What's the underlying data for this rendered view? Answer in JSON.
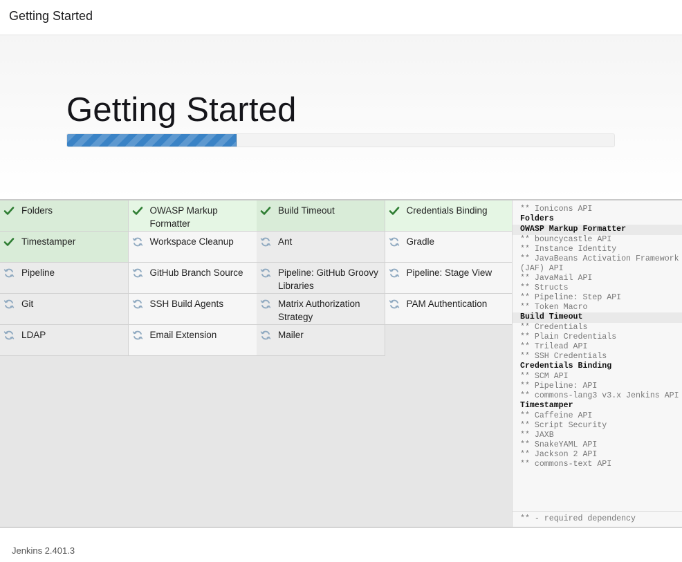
{
  "header": {
    "title": "Getting Started"
  },
  "hero": {
    "title": "Getting Started",
    "progress_fraction": 0.31
  },
  "colors": {
    "success_check": "#2e7d32",
    "spinner": "#8fa9c0",
    "progress": "#3a83c6"
  },
  "plugins": [
    {
      "label": "Folders",
      "status": "installed",
      "icon": "check-icon"
    },
    {
      "label": "OWASP Markup Formatter",
      "status": "installed",
      "icon": "check-icon"
    },
    {
      "label": "Build Timeout",
      "status": "installed",
      "icon": "check-icon"
    },
    {
      "label": "Credentials Binding",
      "status": "installed",
      "icon": "check-icon"
    },
    {
      "label": "Timestamper",
      "status": "installed",
      "icon": "check-icon"
    },
    {
      "label": "Workspace Cleanup",
      "status": "pending",
      "icon": "refresh-icon"
    },
    {
      "label": "Ant",
      "status": "pending",
      "icon": "refresh-icon"
    },
    {
      "label": "Gradle",
      "status": "pending",
      "icon": "refresh-icon"
    },
    {
      "label": "Pipeline",
      "status": "pending",
      "icon": "refresh-icon"
    },
    {
      "label": "GitHub Branch Source",
      "status": "pending",
      "icon": "refresh-icon"
    },
    {
      "label": "Pipeline: GitHub Groovy Libraries",
      "status": "pending",
      "icon": "refresh-icon"
    },
    {
      "label": "Pipeline: Stage View",
      "status": "pending",
      "icon": "refresh-icon"
    },
    {
      "label": "Git",
      "status": "pending",
      "icon": "refresh-icon"
    },
    {
      "label": "SSH Build Agents",
      "status": "pending",
      "icon": "refresh-icon"
    },
    {
      "label": "Matrix Authorization Strategy",
      "status": "pending",
      "icon": "refresh-icon"
    },
    {
      "label": "PAM Authentication",
      "status": "pending",
      "icon": "refresh-icon"
    },
    {
      "label": "LDAP",
      "status": "pending",
      "icon": "refresh-icon"
    },
    {
      "label": "Email Extension",
      "status": "pending",
      "icon": "refresh-icon"
    },
    {
      "label": "Mailer",
      "status": "pending",
      "icon": "refresh-icon"
    }
  ],
  "log": [
    {
      "text": "** Ionicons API",
      "head": false
    },
    {
      "text": "Folders",
      "head": true
    },
    {
      "text": "OWASP Markup Formatter",
      "head": true,
      "highlight": true
    },
    {
      "text": "** bouncycastle API",
      "head": false
    },
    {
      "text": "** Instance Identity",
      "head": false
    },
    {
      "text": "** JavaBeans Activation Framework (JAF) API",
      "head": false
    },
    {
      "text": "** JavaMail API",
      "head": false
    },
    {
      "text": "** Structs",
      "head": false
    },
    {
      "text": "** Pipeline: Step API",
      "head": false
    },
    {
      "text": "** Token Macro",
      "head": false
    },
    {
      "text": "Build Timeout",
      "head": true,
      "highlight": true
    },
    {
      "text": "** Credentials",
      "head": false
    },
    {
      "text": "** Plain Credentials",
      "head": false
    },
    {
      "text": "** Trilead API",
      "head": false
    },
    {
      "text": "** SSH Credentials",
      "head": false
    },
    {
      "text": "Credentials Binding",
      "head": true
    },
    {
      "text": "** SCM API",
      "head": false
    },
    {
      "text": "** Pipeline: API",
      "head": false
    },
    {
      "text": "** commons-lang3 v3.x Jenkins API",
      "head": false
    },
    {
      "text": "Timestamper",
      "head": true
    },
    {
      "text": "** Caffeine API",
      "head": false
    },
    {
      "text": "** Script Security",
      "head": false
    },
    {
      "text": "** JAXB",
      "head": false
    },
    {
      "text": "** SnakeYAML API",
      "head": false
    },
    {
      "text": "** Jackson 2 API",
      "head": false
    },
    {
      "text": "** commons-text API",
      "head": false
    }
  ],
  "log_footer": "** - required dependency",
  "footer": {
    "version": "Jenkins 2.401.3"
  }
}
